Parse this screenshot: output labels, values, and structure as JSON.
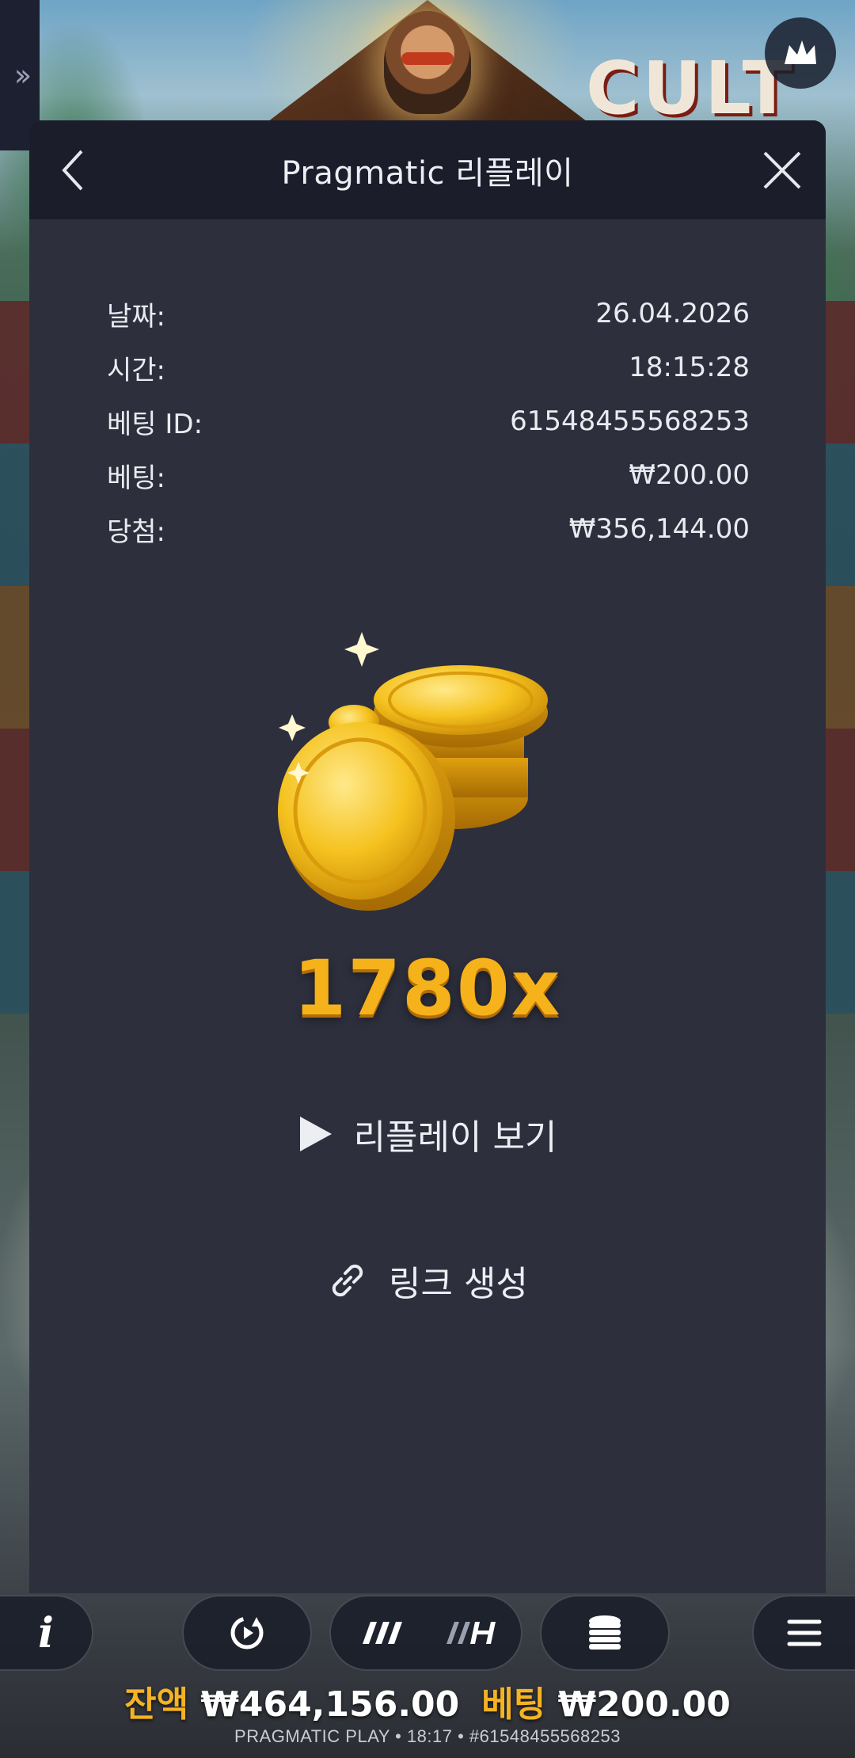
{
  "background": {
    "logo_text": "CULT"
  },
  "modal": {
    "title": "Pragmatic 리플레이",
    "details": [
      {
        "label": "날짜:",
        "value": "26.04.2026"
      },
      {
        "label": "시간:",
        "value": "18:15:28"
      },
      {
        "label": "베팅 ID:",
        "value": "61548455568253"
      },
      {
        "label": "베팅:",
        "value": "₩200.00"
      },
      {
        "label": "당첨:",
        "value": "₩356,144.00"
      }
    ],
    "multiplier": "1780x",
    "replay_label": "리플레이 보기",
    "link_label": "링크 생성"
  },
  "bottom_bar": {
    "info_label": "i",
    "balance_label": "잔액",
    "balance_value": "₩464,156.00",
    "bet_label": "베팅",
    "bet_value": "₩200.00",
    "footer": "PRAGMATIC PLAY • 18:17 • #61548455568253"
  },
  "colors": {
    "accent_gold": "#f5b324",
    "modal_bg": "#2d2f3d",
    "header_bg": "#1b1d2b"
  },
  "icons": {
    "back": "chevron-left-icon",
    "close": "close-icon",
    "play": "play-icon",
    "link": "link-icon",
    "autoplay": "autoplay-icon",
    "speed": "turbo-speed-icon",
    "bet": "coin-stack-icon",
    "menu": "hamburger-menu-icon",
    "crown": "crown-icon"
  }
}
